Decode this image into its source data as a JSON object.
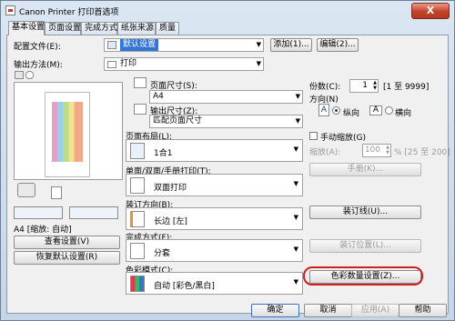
{
  "window": {
    "title": "Canon Printer 打印首选项",
    "close_label": "X"
  },
  "tabs": [
    "基本设置",
    "页面设置",
    "完成方式",
    "纸张来源",
    "质量"
  ],
  "top": {
    "profile_label": "配置文件(E):",
    "profile_value": "默认设置",
    "add_button": "添加(1)...",
    "edit_button": "编辑(2)...",
    "output_label": "输出方法(M):",
    "output_value": "打印"
  },
  "preview": {
    "info": "A4 [缩放: 自动]",
    "view_settings_button": "查看设置(V)",
    "restore_defaults_button": "恢复默认设置(R)"
  },
  "mid": {
    "page_size_label": "页面尺寸(S):",
    "page_size_value": "A4",
    "output_size_label": "输出尺寸(Z):",
    "output_size_value": "匹配页面尺寸",
    "layout_label": "页面布局(L):",
    "layout_value": "1合1",
    "duplex_label": "单面/双面/手册打印(T):",
    "duplex_value": "双面打印",
    "binding_label": "装订方向(B):",
    "binding_value": "长边 [左]",
    "finishing_label": "完成方式(F):",
    "finishing_value": "分套",
    "color_mode_label": "色彩模式(C):",
    "color_mode_value": "自动 [彩色/黑白]"
  },
  "right": {
    "copies_label": "份数(C):",
    "copies_value": "1",
    "copies_range": "[1 至 9999]",
    "orientation_label": "方向(N)",
    "portrait_label": "纵向",
    "landscape_label": "横向",
    "manual_scaling_label": "手动缩放(G)",
    "scaling_label": "缩放(A):",
    "scaling_value": "100",
    "scaling_range": "% [25 至 200]",
    "booklet_button": "手册(K)...",
    "binding_margin_button": "装订线(U)...",
    "staple_location_button": "装订位置(L)...",
    "color_settings_button": "色彩数量设置(Z)..."
  },
  "footer": {
    "ok": "确定",
    "cancel": "取消",
    "apply": "应用(A)",
    "help": "帮助"
  }
}
